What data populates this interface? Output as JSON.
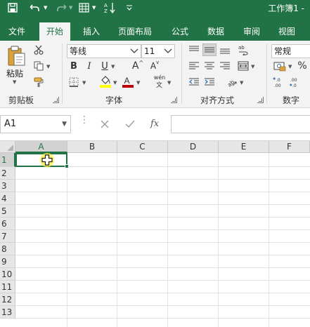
{
  "title_bar": {
    "document_title": "工作簿1 -",
    "qat": [
      {
        "name": "save-icon"
      },
      {
        "name": "undo-icon"
      },
      {
        "name": "redo-icon"
      },
      {
        "name": "form-icon"
      },
      {
        "name": "sort-az-icon"
      },
      {
        "name": "customize-qat-icon"
      }
    ]
  },
  "tabs": [
    {
      "label": "文件",
      "active": false
    },
    {
      "label": "开始",
      "active": true
    },
    {
      "label": "插入",
      "active": false
    },
    {
      "label": "页面布局",
      "active": false
    },
    {
      "label": "公式",
      "active": false
    },
    {
      "label": "数据",
      "active": false
    },
    {
      "label": "审阅",
      "active": false
    },
    {
      "label": "视图",
      "active": false
    }
  ],
  "ribbon": {
    "clipboard": {
      "group_label": "剪贴板",
      "paste_label": "粘贴"
    },
    "font": {
      "group_label": "字体",
      "font_name": "等线",
      "font_size": "11",
      "bold": "B",
      "italic": "I",
      "underline": "U",
      "grow": "A",
      "shrink": "A",
      "phonetic": "wén"
    },
    "alignment": {
      "group_label": "对齐方式"
    },
    "number": {
      "group_label": "数字",
      "format": "常规",
      "percent": "%"
    }
  },
  "formula_bar": {
    "name_box": "A1",
    "fx_label": "fx",
    "formula": ""
  },
  "sheet": {
    "columns": [
      "A",
      "B",
      "C",
      "D",
      "E",
      "F"
    ],
    "rows": [
      "1",
      "2",
      "3",
      "4",
      "5",
      "6",
      "7",
      "8",
      "9",
      "10",
      "11",
      "12",
      "13"
    ],
    "active_cell": "A1"
  },
  "colors": {
    "accent": "#217346",
    "ribbon_bg": "#f3f3f3",
    "font_color_bar": "#c00000",
    "fill_color_bar": "#ffff00",
    "cursor_halo": "#ffee3c"
  }
}
